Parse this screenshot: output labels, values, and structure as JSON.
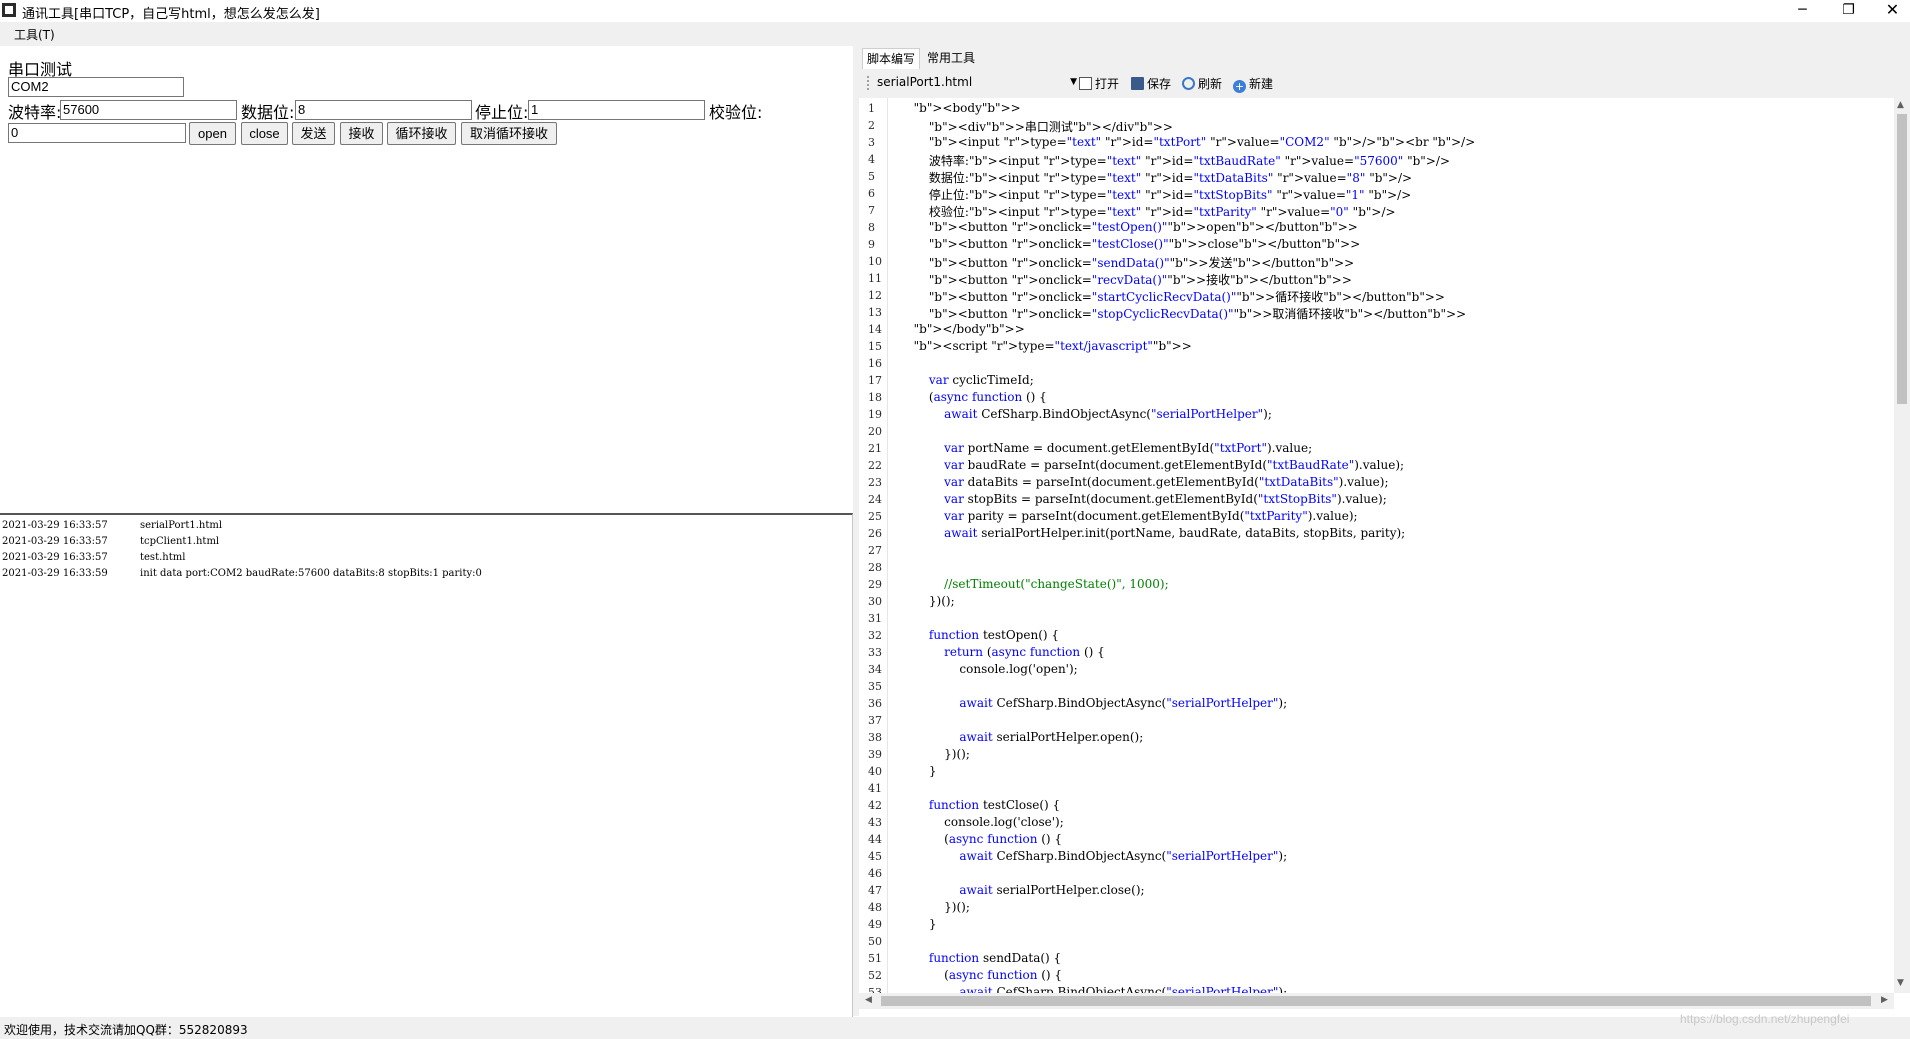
{
  "window": {
    "title": "通讯工具[串口TCP，自己写html，想怎么发怎么发]",
    "minimize": "─",
    "restore": "❐",
    "close": "✕"
  },
  "menu": {
    "tools": "工具(T)"
  },
  "form": {
    "heading": "串口测试",
    "port_value": "COM2",
    "baud_label": "波特率:",
    "baud_value": "57600",
    "databits_label": "数据位:",
    "databits_value": "8",
    "stopbits_label": "停止位:",
    "stopbits_value": "1",
    "parity_label": "校验位:",
    "parity_value": "0",
    "buttons": [
      "open",
      "close",
      "发送",
      "接收",
      "循环接收",
      "取消循环接收"
    ]
  },
  "log": [
    {
      "time": "2021-03-29 16:33:57",
      "message": "serialPort1.html"
    },
    {
      "time": "2021-03-29 16:33:57",
      "message": "tcpClient1.html"
    },
    {
      "time": "2021-03-29 16:33:57",
      "message": "test.html"
    },
    {
      "time": "2021-03-29 16:33:59",
      "message": "init data port:COM2 baudRate:57600 dataBits:8 stopBits:1 parity:0"
    }
  ],
  "tabs": [
    "脚本编写",
    "常用工具"
  ],
  "toolbar": {
    "file": "serialPort1.html",
    "open": "打开",
    "save": "保存",
    "refresh": "刷新",
    "new": "新建",
    "open_icon": "open-file-icon",
    "save_icon": "floppy-disk-icon",
    "refresh_icon": "refresh-icon",
    "new_icon": "plus-circle-icon"
  },
  "code_lines": [
    "  <body>",
    "      <div>串口测试</div>",
    "      <input type=\"text\" id=\"txtPort\" value=\"COM2\" /><br />",
    "      波特率:<input type=\"text\" id=\"txtBaudRate\" value=\"57600\" />",
    "      数据位:<input type=\"text\" id=\"txtDataBits\" value=\"8\" />",
    "      停止位:<input type=\"text\" id=\"txtStopBits\" value=\"1\" />",
    "      校验位:<input type=\"text\" id=\"txtParity\" value=\"0\" />",
    "      <button onclick=\"testOpen()\">open</button>",
    "      <button onclick=\"testClose()\">close</button>",
    "      <button onclick=\"sendData()\">发送</button>",
    "      <button onclick=\"recvData()\">接收</button>",
    "      <button onclick=\"startCyclicRecvData()\">循环接收</button>",
    "      <button onclick=\"stopCyclicRecvData()\">取消循环接收</button>",
    "  </body>",
    "  <script type=\"text/javascript\">",
    "",
    "      var cyclicTimeId;",
    "      (async function () {",
    "          await CefSharp.BindObjectAsync(\"serialPortHelper\");",
    "",
    "          var portName = document.getElementById(\"txtPort\").value;",
    "          var baudRate = parseInt(document.getElementById(\"txtBaudRate\").value);",
    "          var dataBits = parseInt(document.getElementById(\"txtDataBits\").value);",
    "          var stopBits = parseInt(document.getElementById(\"txtStopBits\").value);",
    "          var parity = parseInt(document.getElementById(\"txtParity\").value);",
    "          await serialPortHelper.init(portName, baudRate, dataBits, stopBits, parity);",
    "",
    "",
    "          //setTimeout(\"changeState()\", 1000);",
    "      })();",
    "",
    "      function testOpen() {",
    "          return (async function () {",
    "              console.log('open');",
    "",
    "              await CefSharp.BindObjectAsync(\"serialPortHelper\");",
    "",
    "              await serialPortHelper.open();",
    "          })();",
    "      }",
    "",
    "      function testClose() {",
    "          console.log('close');",
    "          (async function () {",
    "              await CefSharp.BindObjectAsync(\"serialPortHelper\");",
    "",
    "              await serialPortHelper.close();",
    "          })();",
    "      }",
    "",
    "      function sendData() {",
    "          (async function () {",
    "              await CefSharp.BindObjectAsync(\"serialPortHelper\");"
  ],
  "status": "欢迎使用，技术交流请加QQ群：552820893",
  "watermark": "https://blog.csdn.net/zhupengfei"
}
